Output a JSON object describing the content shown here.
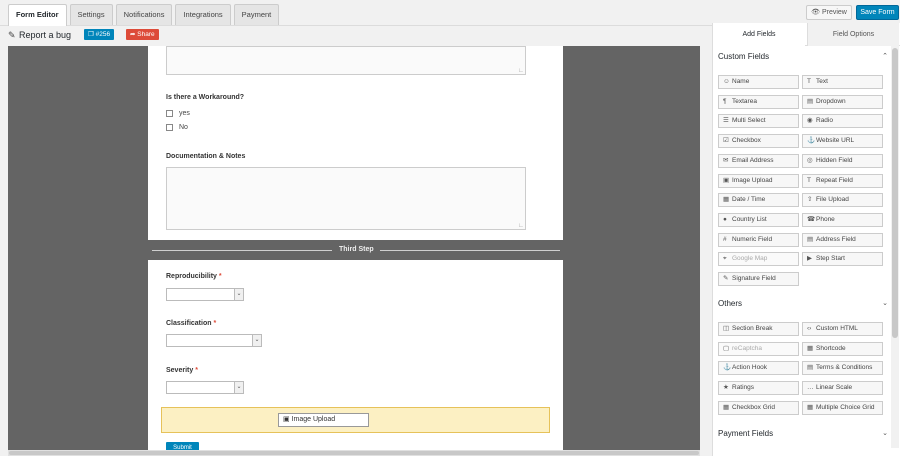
{
  "tabs": [
    "Form Editor",
    "Settings",
    "Notifications",
    "Integrations",
    "Payment"
  ],
  "header": {
    "preview_label": "Preview",
    "save_label": "Save Form"
  },
  "form": {
    "title": "Report a bug",
    "id_badge": "#256",
    "share_label": "Share"
  },
  "canvas": {
    "workaround_label": "Is there a Workaround?",
    "workaround_options": [
      "yes",
      "No"
    ],
    "notes_label": "Documentation & Notes",
    "step_label": "Third Step",
    "reproducibility_label": "Reproducibility",
    "classification_label": "Classification",
    "severity_label": "Severity",
    "required_mark": "*",
    "drag_chip_label": "Image Upload",
    "submit_label": "Submit"
  },
  "panel": {
    "tabs": {
      "add_fields": "Add Fields",
      "field_options": "Field Options"
    },
    "custom_fields_title": "Custom Fields",
    "custom_fields": [
      {
        "label": "Name",
        "icon": "user-icon"
      },
      {
        "label": "Text",
        "icon": "text-icon"
      },
      {
        "label": "Textarea",
        "icon": "paragraph-icon"
      },
      {
        "label": "Dropdown",
        "icon": "dropdown-icon"
      },
      {
        "label": "Multi Select",
        "icon": "list-icon"
      },
      {
        "label": "Radio",
        "icon": "radio-icon"
      },
      {
        "label": "Checkbox",
        "icon": "checkbox-icon"
      },
      {
        "label": "Website URL",
        "icon": "link-icon"
      },
      {
        "label": "Email Address",
        "icon": "envelope-icon"
      },
      {
        "label": "Hidden Field",
        "icon": "eye-slash-icon"
      },
      {
        "label": "Image Upload",
        "icon": "image-icon"
      },
      {
        "label": "Repeat Field",
        "icon": "repeat-icon"
      },
      {
        "label": "Date / Time",
        "icon": "calendar-icon"
      },
      {
        "label": "File Upload",
        "icon": "upload-icon"
      },
      {
        "label": "Country List",
        "icon": "globe-icon"
      },
      {
        "label": "Phone",
        "icon": "phone-icon"
      },
      {
        "label": "Numeric Field",
        "icon": "hash-icon"
      },
      {
        "label": "Address Field",
        "icon": "address-card-icon"
      },
      {
        "label": "Google Map",
        "icon": "map-marker-icon",
        "disabled": true
      },
      {
        "label": "Step Start",
        "icon": "step-icon"
      },
      {
        "label": "Signature Field",
        "icon": "pen-icon"
      }
    ],
    "others_title": "Others",
    "others_fields": [
      {
        "label": "Section Break",
        "icon": "columns-icon"
      },
      {
        "label": "Custom HTML",
        "icon": "code-icon"
      },
      {
        "label": "reCaptcha",
        "icon": "captcha-icon",
        "disabled": true
      },
      {
        "label": "Shortcode",
        "icon": "shortcode-icon"
      },
      {
        "label": "Action Hook",
        "icon": "anchor-icon"
      },
      {
        "label": "Terms & Conditions",
        "icon": "terms-icon"
      },
      {
        "label": "Ratings",
        "icon": "star-icon"
      },
      {
        "label": "Linear Scale",
        "icon": "ellipsis-icon"
      },
      {
        "label": "Checkbox Grid",
        "icon": "grid-icon"
      },
      {
        "label": "Multiple Choice Grid",
        "icon": "choice-grid-icon"
      }
    ],
    "payment_title": "Payment Fields"
  }
}
